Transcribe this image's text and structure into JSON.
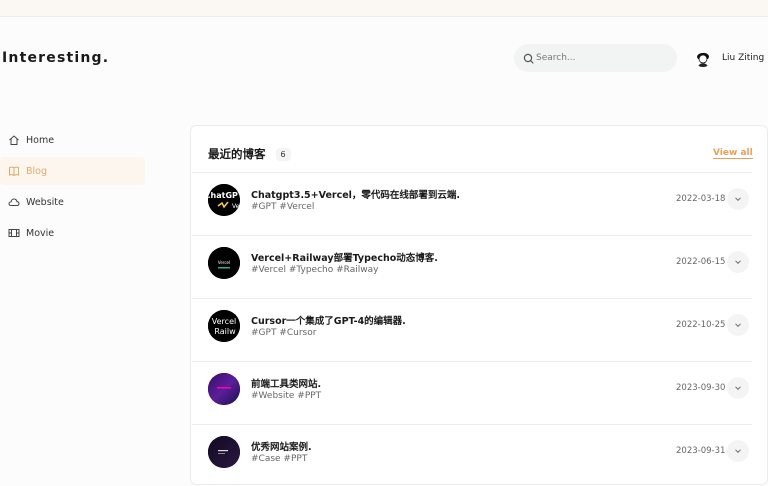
{
  "header": {
    "logo": "Interesting.",
    "search_placeholder": "Search...",
    "username": "Liu Ziting"
  },
  "sidebar": {
    "items": [
      {
        "label": "Home",
        "icon": "home-icon"
      },
      {
        "label": "Blog",
        "icon": "book-icon",
        "active": true
      },
      {
        "label": "Website",
        "icon": "cloud-icon"
      },
      {
        "label": "Movie",
        "icon": "film-icon"
      }
    ]
  },
  "blog": {
    "title": "最近的博客",
    "count": "6",
    "view_all": "View all",
    "posts": [
      {
        "title": "Chatgpt3.5+Vercel，零代码在线部署到云端.",
        "tags": "#GPT #Vercel",
        "date": "2022-03-18",
        "thumb_text": "ChatGPT"
      },
      {
        "title": "Vercel+Railway部署Typecho动态博客.",
        "tags": "#Vercel #Typecho #Railway",
        "date": "2022-06-15",
        "thumb_text": "Vercel"
      },
      {
        "title": "Cursor一个集成了GPT-4的编辑器.",
        "tags": "#GPT #Cursor",
        "date": "2022-10-25",
        "thumb_text": "Vercel Railway"
      },
      {
        "title": "前端工具类网站.",
        "tags": "#Website #PPT",
        "date": "2023-09-30"
      },
      {
        "title": "优秀网站案例.",
        "tags": "#Case #PPT",
        "date": "2023-09-31"
      }
    ]
  }
}
